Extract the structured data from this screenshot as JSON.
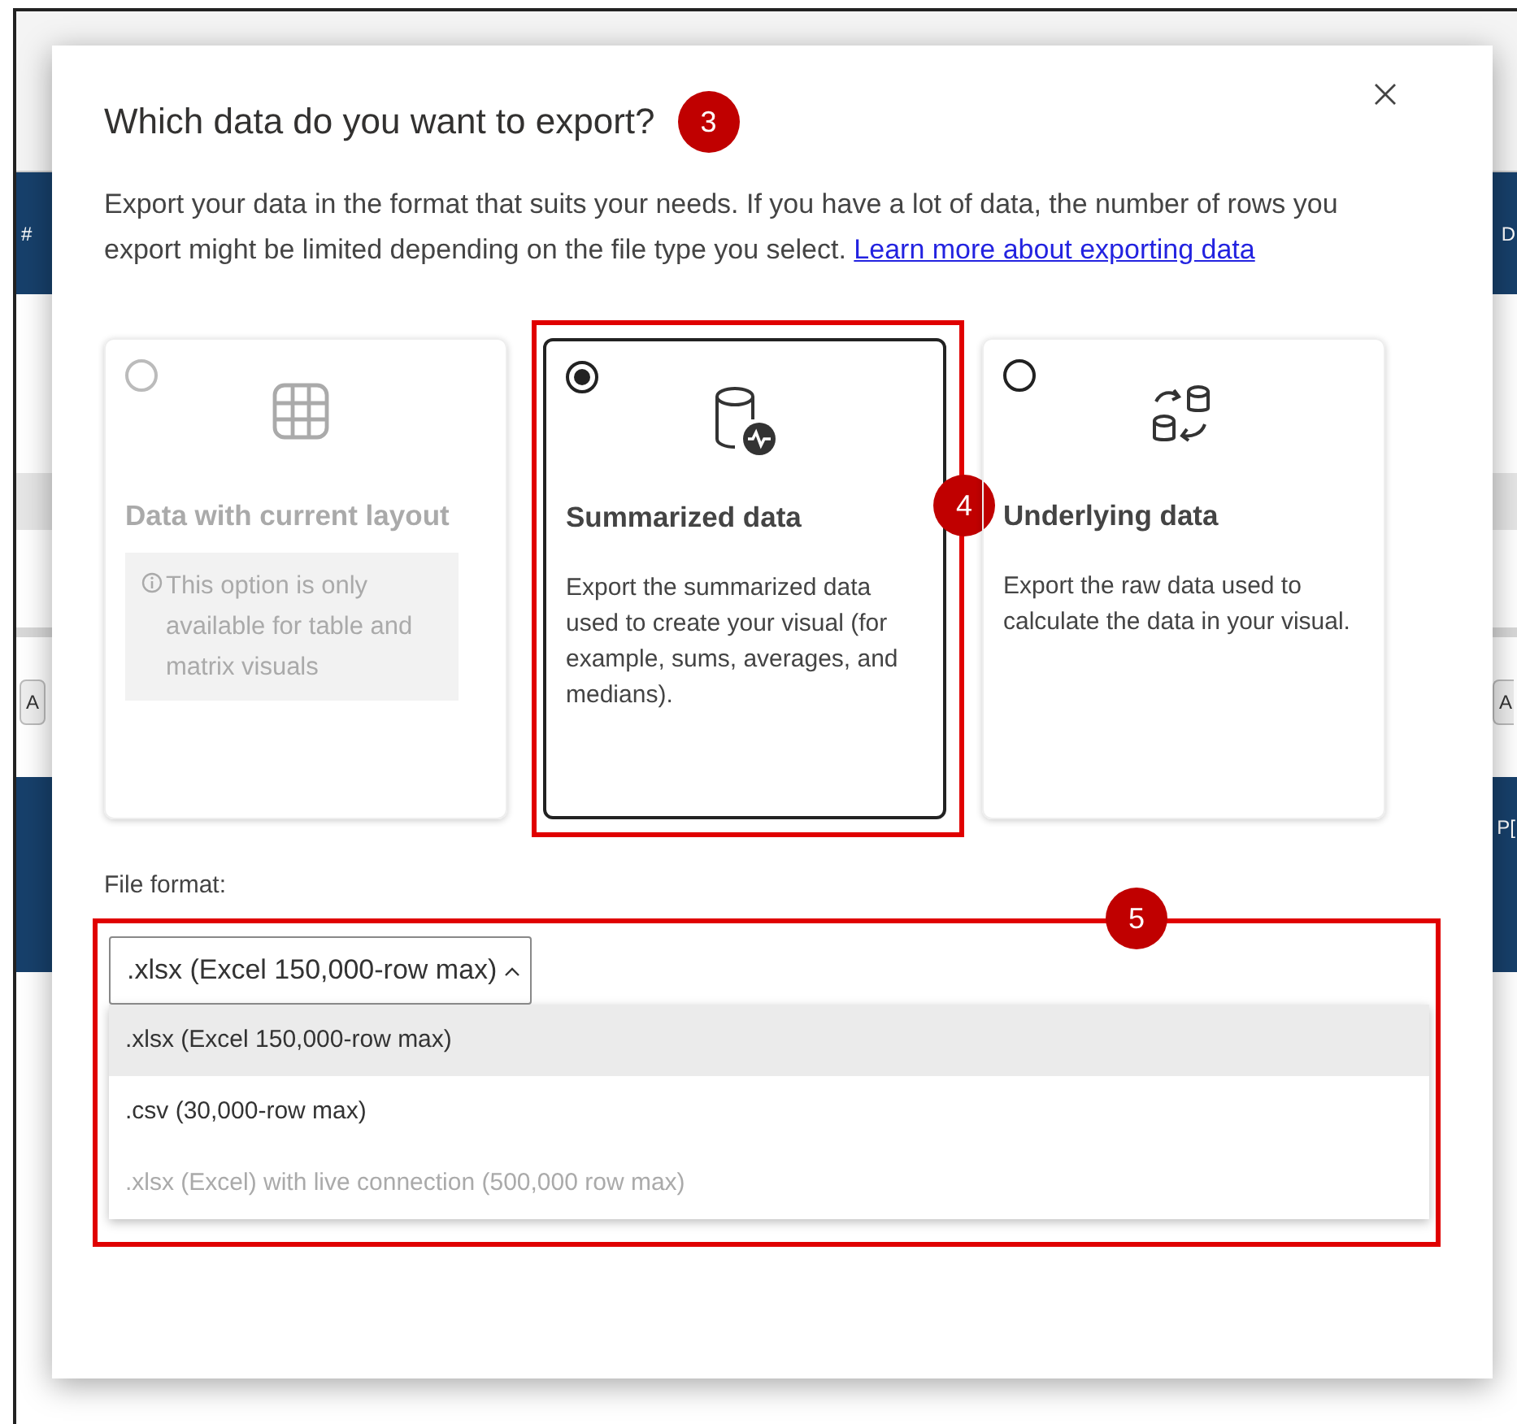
{
  "backdrop": {
    "fragments": [
      {
        "text": "#"
      },
      {
        "text": "D"
      },
      {
        "text": "A"
      },
      {
        "text": "A"
      },
      {
        "text": "P["
      }
    ]
  },
  "dialog": {
    "title": "Which data do you want to export?",
    "badge": "3",
    "description": "Export your data in the format that suits your needs. If you have a lot of data, the number of rows you export might be limited depending on the file type you select.",
    "link": "Learn more about exporting data"
  },
  "options": [
    {
      "kind": "table",
      "title": "Data with current layout",
      "note": "This option is only available for table and matrix visuals",
      "selected": false,
      "disabled": true
    },
    {
      "kind": "summarized",
      "title": "Summarized data",
      "description": "Export the summarized data used to create your visual (for example, sums, averages, and medians).",
      "selected": true,
      "disabled": false,
      "badge": "4"
    },
    {
      "kind": "underlying",
      "title": "Underlying data",
      "description": "Export the raw data used to calculate the data in your visual.",
      "selected": false,
      "disabled": false
    }
  ],
  "file_format": {
    "label": "File format:",
    "value": ".xlsx (Excel 150,000-row max)",
    "expanded": true,
    "badge": "5",
    "options": [
      {
        "label": ".xlsx (Excel 150,000-row max)",
        "selected": true,
        "disabled": false
      },
      {
        "label": ".csv (30,000-row max)",
        "selected": false,
        "disabled": false
      },
      {
        "label": ".xlsx (Excel) with live connection (500,000 row max)",
        "selected": false,
        "disabled": true
      }
    ]
  }
}
